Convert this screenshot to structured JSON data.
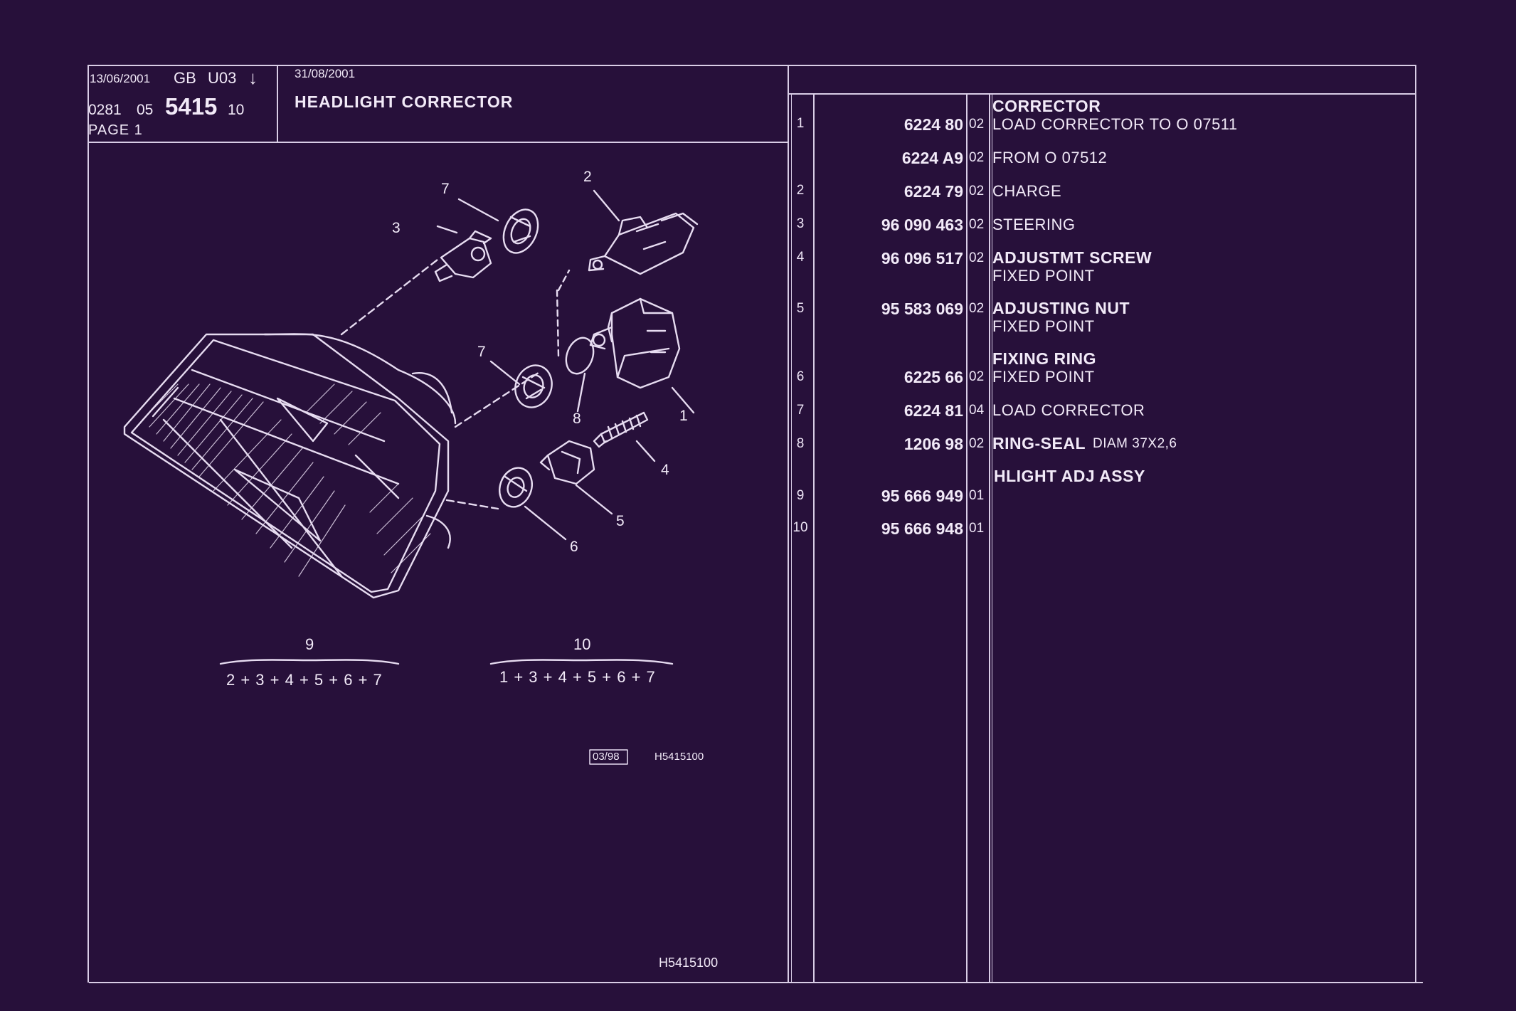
{
  "header": {
    "date_left": "13/06/2001",
    "lang": "GB",
    "code": "U03",
    "arrow": "↓",
    "ref_prefix": "0281",
    "ref_group": "05",
    "ref_main": "5415",
    "ref_suffix": "10",
    "page": "PAGE 1",
    "date_right": "31/08/2001",
    "title": "HEADLIGHT CORRECTOR"
  },
  "diagram": {
    "callouts": [
      "1",
      "2",
      "3",
      "4",
      "5",
      "6",
      "7",
      "7",
      "8"
    ],
    "assembly_9_label": "9",
    "assembly_9_formula": "2 + 3 + 4 + 5 + 6 + 7",
    "assembly_10_label": "10",
    "assembly_10_formula": "1 + 3 + 4 + 5 + 6 + 7",
    "date_box": "03/98",
    "drawing_ref": "H5415100",
    "footer_ref": "H5415100"
  },
  "parts": {
    "rows": [
      {
        "idx": "",
        "part": "",
        "qty": "",
        "desc": "CORRECTOR",
        "desc_bold": true,
        "sub": ""
      },
      {
        "idx": "1",
        "part": "6224 80",
        "qty": "02",
        "desc": "LOAD CORRECTOR TO  O  07511",
        "desc_bold": false,
        "sub": ""
      },
      {
        "idx": "",
        "part": "6224 A9",
        "qty": "02",
        "desc": "FROM  O  07512",
        "desc_bold": false,
        "sub": ""
      },
      {
        "idx": "2",
        "part": "6224 79",
        "qty": "02",
        "desc": "CHARGE",
        "desc_bold": false,
        "sub": ""
      },
      {
        "idx": "3",
        "part": "96 090 463",
        "qty": "02",
        "desc": "STEERING",
        "desc_bold": false,
        "sub": ""
      },
      {
        "idx": "4",
        "part": "96 096 517",
        "qty": "02",
        "desc": "ADJUSTMT SCREW",
        "desc_bold": true,
        "sub": "FIXED POINT"
      },
      {
        "idx": "5",
        "part": "95 583 069",
        "qty": "02",
        "desc": "ADJUSTING NUT",
        "desc_bold": true,
        "sub": "FIXED POINT"
      },
      {
        "idx": "",
        "part": "",
        "qty": "",
        "desc": "FIXING RING",
        "desc_bold": true,
        "sub": ""
      },
      {
        "idx": "6",
        "part": "6225 66",
        "qty": "02",
        "desc": "FIXED POINT",
        "desc_bold": false,
        "sub": ""
      },
      {
        "idx": "7",
        "part": "6224 81",
        "qty": "04",
        "desc": "LOAD CORRECTOR",
        "desc_bold": false,
        "sub": ""
      },
      {
        "idx": "8",
        "part": "1206 98",
        "qty": "02",
        "desc": "RING-SEAL",
        "desc_bold": true,
        "extra": "DIAM 37X2,6",
        "sub": ""
      },
      {
        "idx": "",
        "part": "",
        "qty": "",
        "desc": "HLIGHT ADJ ASSY",
        "desc_bold": true,
        "sub": ""
      },
      {
        "idx": "9",
        "part": "95 666 949",
        "qty": "01",
        "desc": "",
        "desc_bold": false,
        "sub": ""
      },
      {
        "idx": "10",
        "part": "95 666 948",
        "qty": "01",
        "desc": "",
        "desc_bold": false,
        "sub": ""
      }
    ]
  },
  "colors": {
    "background": "#27103a",
    "ink": "#efe6f7",
    "rule": "#d9cde6"
  }
}
